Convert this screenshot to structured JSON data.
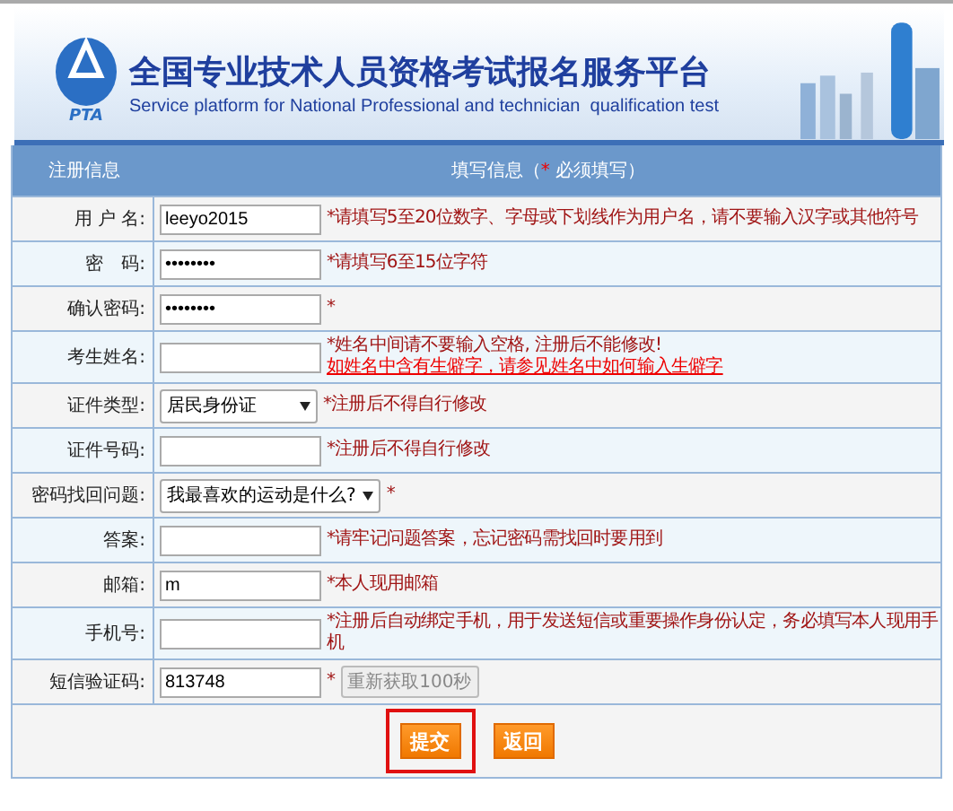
{
  "banner": {
    "logo": "PTA",
    "title": "全国专业技术人员资格考试报名服务平台",
    "subtitle": "Service platform for National Professional and technician  qualification test"
  },
  "header": {
    "left": "注册信息",
    "right_before": "填写信息（",
    "right_star": "*",
    "right_after": " 必须填写）"
  },
  "rows": [
    {
      "kind": "text",
      "label": "用 户 名:",
      "value": "leeyo2015",
      "hint": "*请填写5至20位数字、字母或下划线作为用户名，请不要输入汉字或其他符号"
    },
    {
      "kind": "text",
      "label": "密　码:",
      "value": "••••••••",
      "hint": "*请填写6至15位字符"
    },
    {
      "kind": "text",
      "label": "确认密码:",
      "value": "••••••••",
      "hint": "*"
    },
    {
      "kind": "text",
      "label": "考生姓名:",
      "hint": "*姓名中间请不要输入空格, 注册后不能修改!",
      "link": "如姓名中含有生僻字，请参见姓名中如何输入生僻字"
    },
    {
      "kind": "select",
      "label": "证件类型:",
      "value": "居民身份证",
      "hint": "*注册后不得自行修改"
    },
    {
      "kind": "text",
      "label": "证件号码:",
      "hint": "*注册后不得自行修改"
    },
    {
      "kind": "select",
      "label": "密码找回问题:",
      "value": "我最喜欢的运动是什么?",
      "hint": "*"
    },
    {
      "kind": "text",
      "label": "答案:",
      "hint": "*请牢记问题答案，忘记密码需找回时要用到"
    },
    {
      "kind": "text",
      "label": "邮箱:",
      "value": "m",
      "hint": "*本人现用邮箱"
    },
    {
      "kind": "text",
      "label": "手机号:",
      "hint": "*注册后自动绑定手机，用于发送短信或重要操作身份认定，务必填写本人现用手机"
    },
    {
      "kind": "text",
      "label": "短信验证码:",
      "value": "813748",
      "hint": "*",
      "button": {
        "label": "重新获取100秒",
        "disabled": true
      }
    }
  ],
  "actions": [
    {
      "label": "提交",
      "selected": true
    },
    {
      "label": "返回",
      "selected": false
    }
  ]
}
